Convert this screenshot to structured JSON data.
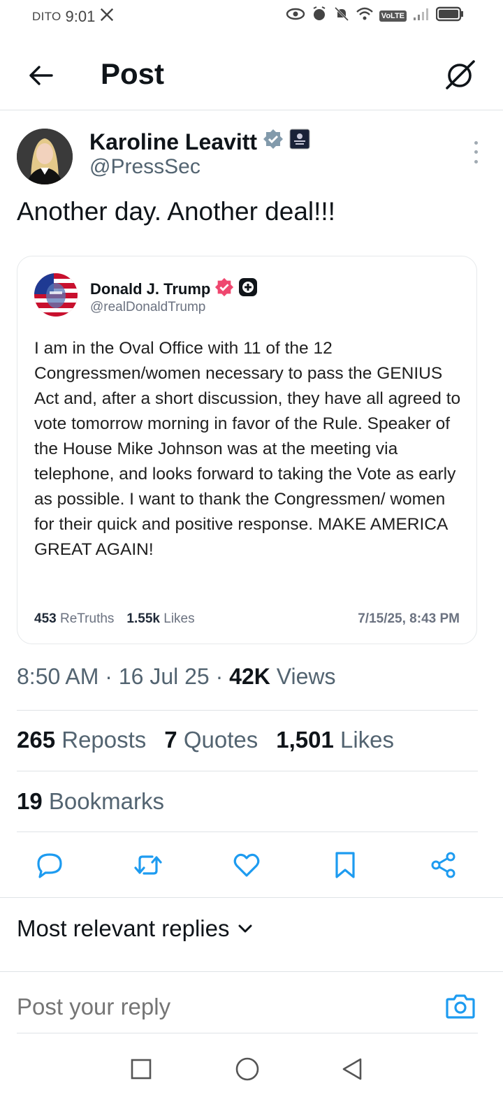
{
  "status_bar": {
    "carrier": "DITO",
    "time": "9:01",
    "network": "VoLTE"
  },
  "header": {
    "title": "Post"
  },
  "author": {
    "name": "Karoline Leavitt",
    "handle": "@PressSec"
  },
  "post": {
    "text": "Another day. Another deal!!!"
  },
  "embed": {
    "name": "Donald J. Trump",
    "handle": "@realDonaldTrump",
    "text": "I am in the Oval Office with 11 of the 12 Congressmen/women necessary to pass the GENIUS Act and, after a short discussion, they have all agreed to vote tomorrow morning in favor of the Rule. Speaker of the House Mike Johnson was at the meeting via telephone, and looks forward to taking the Vote as early as possible. I want to thank the Congressmen/ women for their quick and positive response. MAKE AMERICA GREAT AGAIN!",
    "retruths_count": "453",
    "retruths_label": "ReTruths",
    "likes_count": "1.55k",
    "likes_label": "Likes",
    "date": "7/15/25, 8:43 PM"
  },
  "meta": {
    "time": "8:50 AM",
    "date": "16 Jul 25",
    "views_count": "42K",
    "views_label": "Views"
  },
  "counts": {
    "reposts_count": "265",
    "reposts_label": "Reposts",
    "quotes_count": "7",
    "quotes_label": "Quotes",
    "likes_count": "1,501",
    "likes_label": "Likes",
    "bookmarks_count": "19",
    "bookmarks_label": "Bookmarks"
  },
  "replies": {
    "sort_label": "Most relevant replies"
  },
  "reply_bar": {
    "placeholder": "Post your reply"
  },
  "colors": {
    "verified_blue": "#829aab",
    "accent_blue": "#1d9bf0",
    "truth_badge_pink": "#ef476f",
    "secondary_text": "#536471"
  }
}
